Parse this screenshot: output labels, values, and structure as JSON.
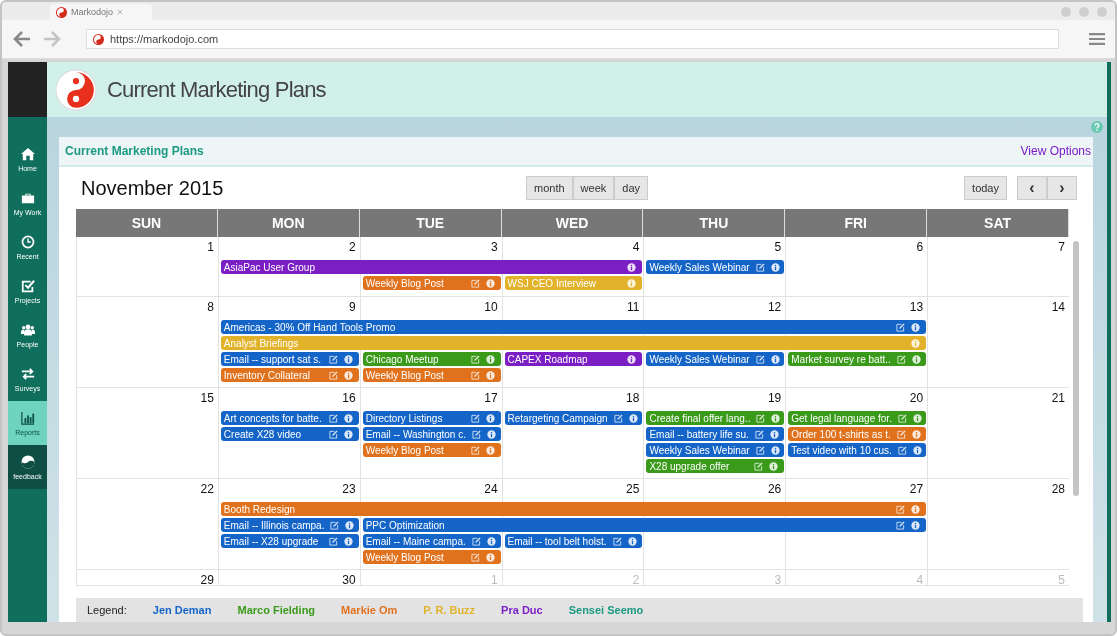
{
  "browser": {
    "tab_title": "Markodojo",
    "url": "https://markodojo.com"
  },
  "header": {
    "title": "Current Marketing Plans"
  },
  "sidebar": {
    "items": [
      {
        "label": "Home",
        "kind": "home",
        "selected": false
      },
      {
        "label": "My Work",
        "kind": "work",
        "selected": false
      },
      {
        "label": "Recent",
        "kind": "recent",
        "selected": false
      },
      {
        "label": "Projects",
        "kind": "projects",
        "selected": false
      },
      {
        "label": "People",
        "kind": "people",
        "selected": false
      },
      {
        "label": "Surveys",
        "kind": "surveys",
        "selected": false
      },
      {
        "label": "Reports",
        "kind": "reports",
        "selected": true
      },
      {
        "label": "feedback",
        "kind": "feedback",
        "selected": false
      }
    ]
  },
  "panel": {
    "title": "Current Marketing Plans",
    "link": "View Options"
  },
  "calendar": {
    "month_title": "November 2015",
    "view_buttons": [
      "month",
      "week",
      "day"
    ],
    "today_button": "today",
    "prev_button": "‹",
    "next_button": "›",
    "day_headers": [
      "SUN",
      "MON",
      "TUE",
      "WED",
      "THU",
      "FRI",
      "SAT"
    ],
    "weeks": [
      {
        "days": [
          {
            "date": "1",
            "other_month": false
          },
          {
            "date": "2",
            "other_month": false
          },
          {
            "date": "3",
            "other_month": false
          },
          {
            "date": "4",
            "other_month": false
          },
          {
            "date": "5",
            "other_month": false
          },
          {
            "date": "6",
            "other_month": false
          },
          {
            "date": "7",
            "other_month": false
          }
        ],
        "lanes": [
          [
            {
              "kind": "empty"
            },
            {
              "kind": "event",
              "title": "AsiaPac User Group",
              "color": "#7b1fc4",
              "editable": false
            },
            {
              "kind": "continued"
            },
            {
              "kind": "continued"
            },
            {
              "kind": "event",
              "title": "Weekly Sales Webinar",
              "color": "#1565c8",
              "editable": true
            },
            {
              "kind": "empty"
            },
            {
              "kind": "empty"
            }
          ],
          [
            {
              "kind": "empty"
            },
            {
              "kind": "empty"
            },
            {
              "kind": "event",
              "title": "Weekly Blog Post",
              "color": "#e0721e",
              "editable": true
            },
            {
              "kind": "event",
              "title": "WSJ CEO Interview",
              "color": "#e2b22a",
              "editable": false
            },
            {
              "kind": "empty"
            },
            {
              "kind": "empty"
            },
            {
              "kind": "empty"
            }
          ]
        ]
      },
      {
        "days": [
          {
            "date": "8",
            "other_month": false
          },
          {
            "date": "9",
            "other_month": false
          },
          {
            "date": "10",
            "other_month": false
          },
          {
            "date": "11",
            "other_month": false
          },
          {
            "date": "12",
            "other_month": false
          },
          {
            "date": "13",
            "other_month": false
          },
          {
            "date": "14",
            "other_month": false
          }
        ],
        "lanes": [
          [
            {
              "kind": "empty"
            },
            {
              "kind": "event",
              "title": "Americas - 30% Off Hand Tools Promo",
              "color": "#1565c8",
              "editable": true
            },
            {
              "kind": "continued"
            },
            {
              "kind": "continued"
            },
            {
              "kind": "continued"
            },
            {
              "kind": "continued"
            },
            {
              "kind": "empty"
            }
          ],
          [
            {
              "kind": "empty"
            },
            {
              "kind": "event",
              "title": "Analyst Briefings",
              "color": "#e2b22a",
              "editable": false
            },
            {
              "kind": "continued"
            },
            {
              "kind": "continued"
            },
            {
              "kind": "continued"
            },
            {
              "kind": "continued"
            },
            {
              "kind": "empty"
            }
          ],
          [
            {
              "kind": "empty"
            },
            {
              "kind": "event",
              "title": "Email -- support sat s.",
              "color": "#1565c8",
              "editable": true
            },
            {
              "kind": "event",
              "title": "Chicago Meetup",
              "color": "#3a9a1a",
              "editable": true
            },
            {
              "kind": "event",
              "title": "CAPEX Roadmap",
              "color": "#7b1fc4",
              "editable": false
            },
            {
              "kind": "event",
              "title": "Weekly Sales Webinar",
              "color": "#1565c8",
              "editable": true
            },
            {
              "kind": "event",
              "title": "Market survey re batt..",
              "color": "#3a9a1a",
              "editable": true
            },
            {
              "kind": "empty"
            }
          ],
          [
            {
              "kind": "empty"
            },
            {
              "kind": "event",
              "title": "Inventory Collateral",
              "color": "#e0721e",
              "editable": true
            },
            {
              "kind": "event",
              "title": "Weekly Blog Post",
              "color": "#e0721e",
              "editable": true
            },
            {
              "kind": "empty"
            },
            {
              "kind": "empty"
            },
            {
              "kind": "empty"
            },
            {
              "kind": "empty"
            }
          ]
        ]
      },
      {
        "days": [
          {
            "date": "15",
            "other_month": false
          },
          {
            "date": "16",
            "other_month": false
          },
          {
            "date": "17",
            "other_month": false
          },
          {
            "date": "18",
            "other_month": false
          },
          {
            "date": "19",
            "other_month": false
          },
          {
            "date": "20",
            "other_month": false
          },
          {
            "date": "21",
            "other_month": false
          }
        ],
        "lanes": [
          [
            {
              "kind": "empty"
            },
            {
              "kind": "event",
              "title": "Art concepts for batte.",
              "color": "#1565c8",
              "editable": true
            },
            {
              "kind": "event",
              "title": "Directory Listings",
              "color": "#1565c8",
              "editable": true
            },
            {
              "kind": "event",
              "title": "Retargeting Campaign",
              "color": "#1565c8",
              "editable": true
            },
            {
              "kind": "event",
              "title": "Create final offer lang..",
              "color": "#3a9a1a",
              "editable": true
            },
            {
              "kind": "event",
              "title": "Get legal language for.",
              "color": "#3a9a1a",
              "editable": true
            },
            {
              "kind": "empty"
            }
          ],
          [
            {
              "kind": "empty"
            },
            {
              "kind": "event",
              "title": "Create X28 video",
              "color": "#1565c8",
              "editable": true
            },
            {
              "kind": "event",
              "title": "Email -- Washington c.",
              "color": "#1565c8",
              "editable": true
            },
            {
              "kind": "empty"
            },
            {
              "kind": "event",
              "title": "Email -- battery life su.",
              "color": "#1565c8",
              "editable": true
            },
            {
              "kind": "event",
              "title": "Order 100 t-shirts as t.",
              "color": "#e0721e",
              "editable": true
            },
            {
              "kind": "empty"
            }
          ],
          [
            {
              "kind": "empty"
            },
            {
              "kind": "empty"
            },
            {
              "kind": "event",
              "title": "Weekly Blog Post",
              "color": "#e0721e",
              "editable": true
            },
            {
              "kind": "empty"
            },
            {
              "kind": "event",
              "title": "Weekly Sales Webinar",
              "color": "#1565c8",
              "editable": true
            },
            {
              "kind": "event",
              "title": "Test video with 10 cus.",
              "color": "#1565c8",
              "editable": true
            },
            {
              "kind": "empty"
            }
          ],
          [
            {
              "kind": "empty"
            },
            {
              "kind": "empty"
            },
            {
              "kind": "empty"
            },
            {
              "kind": "empty"
            },
            {
              "kind": "event",
              "title": "X28 upgrade offer",
              "color": "#3a9a1a",
              "editable": true
            },
            {
              "kind": "empty"
            },
            {
              "kind": "empty"
            }
          ]
        ]
      },
      {
        "days": [
          {
            "date": "22",
            "other_month": false
          },
          {
            "date": "23",
            "other_month": false
          },
          {
            "date": "24",
            "other_month": false
          },
          {
            "date": "25",
            "other_month": false
          },
          {
            "date": "26",
            "other_month": false
          },
          {
            "date": "27",
            "other_month": false
          },
          {
            "date": "28",
            "other_month": false
          }
        ],
        "lanes": [
          [
            {
              "kind": "empty"
            },
            {
              "kind": "event",
              "title": "Booth Redesign",
              "color": "#e0721e",
              "editable": true
            },
            {
              "kind": "continued"
            },
            {
              "kind": "continued"
            },
            {
              "kind": "continued"
            },
            {
              "kind": "continued"
            },
            {
              "kind": "empty"
            }
          ],
          [
            {
              "kind": "empty"
            },
            {
              "kind": "event",
              "title": "Email -- Illinois campa.",
              "color": "#1565c8",
              "editable": true
            },
            {
              "kind": "event",
              "title": "PPC Optimization",
              "color": "#1565c8",
              "editable": true
            },
            {
              "kind": "continued"
            },
            {
              "kind": "continued"
            },
            {
              "kind": "continued"
            },
            {
              "kind": "empty"
            }
          ],
          [
            {
              "kind": "empty"
            },
            {
              "kind": "event",
              "title": "Email -- X28 upgrade",
              "color": "#1565c8",
              "editable": true
            },
            {
              "kind": "event",
              "title": "Email -- Maine campa.",
              "color": "#1565c8",
              "editable": true
            },
            {
              "kind": "event",
              "title": "Email -- tool belt holst.",
              "color": "#1565c8",
              "editable": true
            },
            {
              "kind": "empty"
            },
            {
              "kind": "empty"
            },
            {
              "kind": "empty"
            }
          ],
          [
            {
              "kind": "empty"
            },
            {
              "kind": "empty"
            },
            {
              "kind": "event",
              "title": "Weekly Blog Post",
              "color": "#e0721e",
              "editable": true
            },
            {
              "kind": "empty"
            },
            {
              "kind": "empty"
            },
            {
              "kind": "empty"
            },
            {
              "kind": "empty"
            }
          ]
        ]
      },
      {
        "days": [
          {
            "date": "29",
            "other_month": false
          },
          {
            "date": "30",
            "other_month": false
          },
          {
            "date": "1",
            "other_month": true
          },
          {
            "date": "2",
            "other_month": true
          },
          {
            "date": "3",
            "other_month": true
          },
          {
            "date": "4",
            "other_month": true
          },
          {
            "date": "5",
            "other_month": true
          }
        ]
      }
    ]
  },
  "legend": {
    "label": "Legend:",
    "people": [
      {
        "name": "Jen Deman",
        "color": "#1565c8"
      },
      {
        "name": "Marco Fielding",
        "color": "#3a9a1a"
      },
      {
        "name": "Markie Om",
        "color": "#e0721e"
      },
      {
        "name": "P. R. Buzz",
        "color": "#e2b22a"
      },
      {
        "name": "Pra Duc",
        "color": "#7b1fc4"
      },
      {
        "name": "Sensei Seemo",
        "color": "#1a9a80"
      }
    ]
  }
}
